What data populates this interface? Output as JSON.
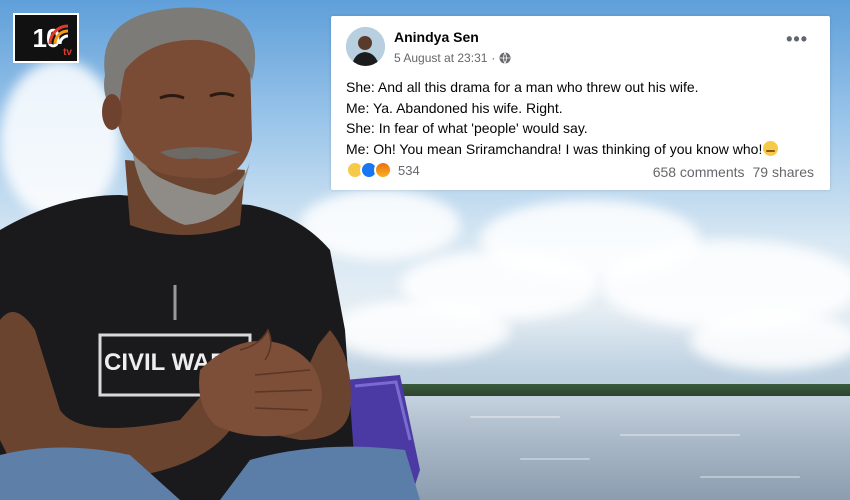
{
  "branding": {
    "logo_text": "10",
    "logo_suffix": "tv"
  },
  "post": {
    "author": "Anindya Sen",
    "timestamp": "5 August at 23:31",
    "more_label": "•••",
    "lines": [
      "She: And all this drama for a man who threw out his wife.",
      "Me: Ya. Abandoned his wife. Right.",
      "She: In fear of what 'people' would say.",
      "Me: Oh! You mean Sriramchandra! I was thinking of you know who!"
    ],
    "reactions": {
      "icons": [
        "haha-icon",
        "like-icon",
        "angry-icon"
      ],
      "count": "534"
    },
    "comments": "658 comments",
    "shares": "79 shares"
  },
  "colors": {
    "fb_like": "#1877f2",
    "haha": "#f7c948",
    "angry": "#e9710f",
    "secondary_text": "#65676b",
    "logo_accent": "#e23b2e"
  }
}
